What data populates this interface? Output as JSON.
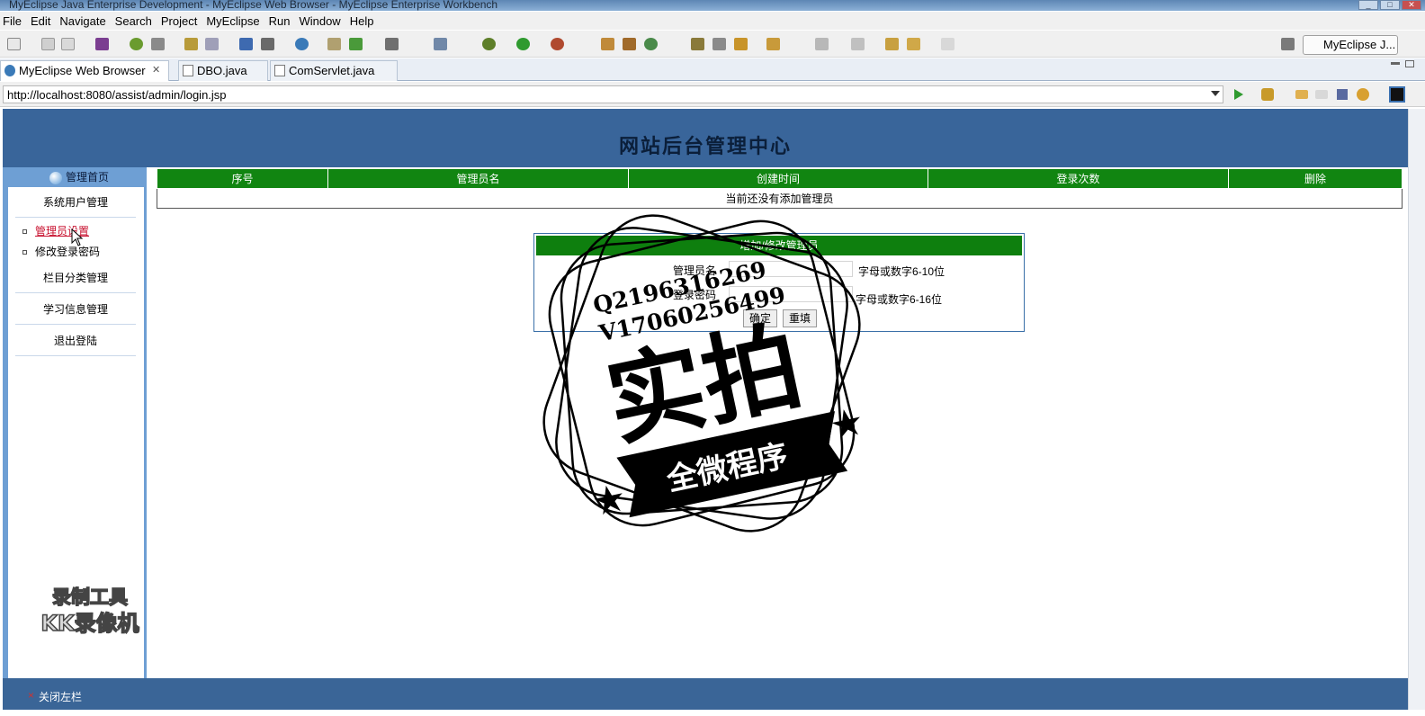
{
  "window": {
    "title": "MyEclipse Java Enterprise Development - MyEclipse Web Browser - MyEclipse Enterprise Workbench",
    "controls": [
      "_",
      "□",
      "✕"
    ]
  },
  "menu": [
    "File",
    "Edit",
    "Navigate",
    "Search",
    "Project",
    "MyEclipse",
    "Run",
    "Window",
    "Help"
  ],
  "perspective": {
    "label": "MyEclipse J..."
  },
  "tabs": [
    {
      "label": "MyEclipse Web Browser",
      "close": "✕"
    },
    {
      "label": "DBO.java"
    },
    {
      "label": "ComServlet.java"
    }
  ],
  "address": {
    "url": "http://localhost:8080/assist/admin/login.jsp"
  },
  "page": {
    "header_title": "网站后台管理中心",
    "sidebar": {
      "home": "管理首页",
      "groups": [
        {
          "label": "系统用户管理"
        },
        {
          "label": "栏目分类管理"
        },
        {
          "label": "学习信息管理"
        },
        {
          "label": "退出登陆"
        }
      ],
      "subitems": [
        {
          "label": "管理员设置"
        },
        {
          "label": "修改登录密码"
        }
      ]
    },
    "table": {
      "columns": [
        "序号",
        "管理员名",
        "创建时间",
        "登录次数",
        "删除"
      ],
      "empty_message": "当前还没有添加管理员"
    },
    "form": {
      "title": "增加/修改管理员",
      "username_label": "管理员名",
      "username_hint": "字母或数字6-10位",
      "password_label": "登录密码",
      "password_hint": "字母或数字6-16位",
      "submit": "确定",
      "reset": "重填"
    },
    "footer": {
      "close_left": "关闭左栏",
      "close_icon": "×"
    }
  },
  "overlays": {
    "recorder_line1": "录制工具",
    "recorder_line2": "KK录像机",
    "stamp_contact1": "Q2196316269",
    "stamp_contact2": "V17060256499",
    "stamp_main": "实拍",
    "stamp_banner": "全微程序"
  }
}
